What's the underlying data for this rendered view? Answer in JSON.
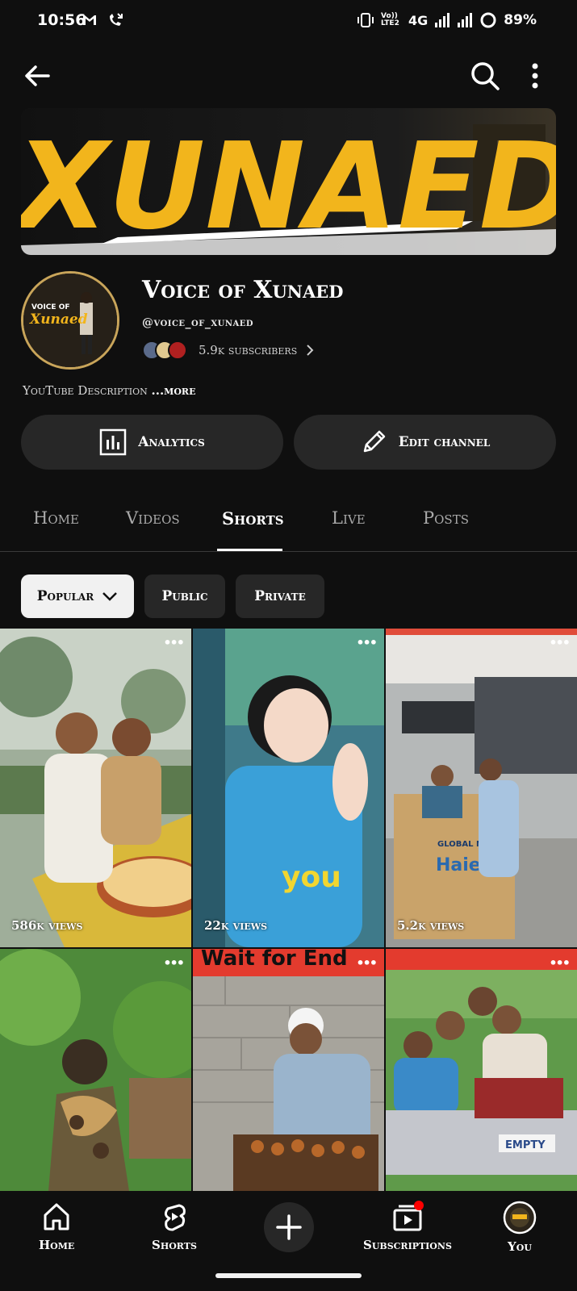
{
  "status": {
    "time": "10:56",
    "network": "4G",
    "battery": "89%",
    "volte": "Vo)) LTE2"
  },
  "channel": {
    "banner_text": "XUNAED",
    "name": "Voice of Xunaed",
    "handle": "@voice_of_xunaed",
    "subscribers": "5.9k subscribers",
    "description": "YouTube Description",
    "more_label": "...more",
    "avatar_text_top": "VOICE OF",
    "avatar_text_main": "Xunaed"
  },
  "actions": {
    "analytics": "Analytics",
    "edit_channel": "Edit channel"
  },
  "tabs": [
    {
      "label": "Home"
    },
    {
      "label": "Videos"
    },
    {
      "label": "Shorts"
    },
    {
      "label": "Live"
    },
    {
      "label": "Posts"
    }
  ],
  "filters": {
    "popular": "Popular",
    "public": "Public",
    "private": "Private"
  },
  "shorts": [
    {
      "views": "586k views"
    },
    {
      "views": "22k views"
    },
    {
      "views": "5.2k views"
    },
    {
      "views": ""
    },
    {
      "views": ""
    },
    {
      "views": ""
    }
  ],
  "nav": {
    "home": "Home",
    "shorts": "Shorts",
    "subscriptions": "Subscriptions",
    "you": "You"
  },
  "colors": {
    "background": "#0f0f0f",
    "surface": "#272727",
    "banner_yellow": "#f2b51c",
    "notification_red": "#ff0000"
  }
}
